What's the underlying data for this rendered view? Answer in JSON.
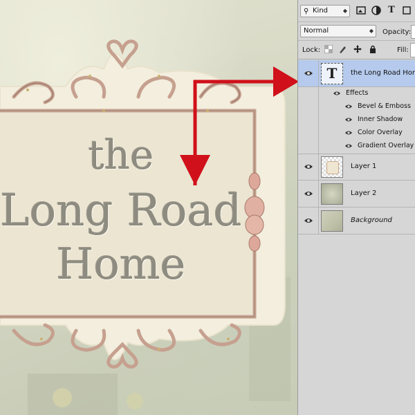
{
  "canvas": {
    "title_line1": "the",
    "title_line2": "Long Road",
    "title_line3": "Home"
  },
  "layers_panel": {
    "filter": {
      "kind_label": "Kind",
      "search_icon": "search-icon",
      "icons": [
        "image-filter-icon",
        "adjustment-filter-icon",
        "type-filter-icon",
        "shape-filter-icon"
      ]
    },
    "blend_mode": "Normal",
    "opacity_label": "Opacity:",
    "lock_label": "Lock:",
    "fill_label": "Fill:",
    "layers": [
      {
        "name": "the Long Road Home",
        "type": "text",
        "selected": true,
        "thumb_glyph": "T"
      },
      {
        "name": "Layer 1",
        "type": "pixel"
      },
      {
        "name": "Layer 2",
        "type": "pixel"
      },
      {
        "name": "Background",
        "type": "background"
      }
    ],
    "effects_label": "Effects",
    "effects": [
      "Bevel & Emboss",
      "Inner Shadow",
      "Color Overlay",
      "Gradient Overlay"
    ]
  },
  "colors": {
    "selected_layer": "#b5caec",
    "annotation_arrow": "#d0101a",
    "panel_bg": "#d6d6d6"
  }
}
